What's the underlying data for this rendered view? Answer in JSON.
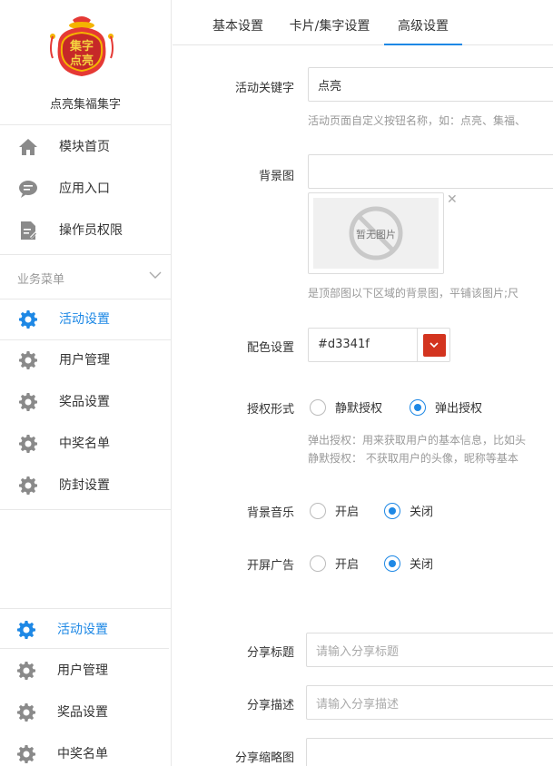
{
  "sidebar": {
    "app_name": "点亮集福集字",
    "logo_text": [
      "集字",
      "点亮"
    ],
    "nav": [
      {
        "label": "模块首页",
        "icon": "home-icon"
      },
      {
        "label": "应用入口",
        "icon": "chat-bubble-icon"
      },
      {
        "label": "操作员权限",
        "icon": "document-edit-icon"
      }
    ],
    "section_title": "业务菜单",
    "menu": [
      {
        "label": "活动设置",
        "active": true
      },
      {
        "label": "用户管理",
        "active": false
      },
      {
        "label": "奖品设置",
        "active": false
      },
      {
        "label": "中奖名单",
        "active": false
      },
      {
        "label": "防封设置",
        "active": false
      }
    ],
    "menu_repeat": [
      {
        "label": "活动设置",
        "active": true
      },
      {
        "label": "用户管理",
        "active": false
      },
      {
        "label": "奖品设置",
        "active": false
      },
      {
        "label": "中奖名单",
        "active": false
      }
    ]
  },
  "tabs": [
    {
      "label": "基本设置",
      "active": false
    },
    {
      "label": "卡片/集字设置",
      "active": false
    },
    {
      "label": "高级设置",
      "active": true
    }
  ],
  "form": {
    "keyword": {
      "label": "活动关键字",
      "value": "点亮",
      "help": "活动页面自定义按钮名称，如：点亮、集福、"
    },
    "bg_image": {
      "label": "背景图",
      "value": "",
      "placeholder_text": "暂无图片",
      "help": "是顶部图以下区域的背景图，平铺该图片;尺"
    },
    "color": {
      "label": "配色设置",
      "value": "#d3341f",
      "swatch": "#d3341f"
    },
    "auth": {
      "label": "授权形式",
      "options": [
        "静默授权",
        "弹出授权"
      ],
      "selected": "弹出授权",
      "help1": "弹出授权：用来获取用户的基本信息，比如头",
      "help2": "静默授权：  不获取用户的头像，昵称等基本"
    },
    "music": {
      "label": "背景音乐",
      "options": [
        "开启",
        "关闭"
      ],
      "selected": "关闭"
    },
    "ad": {
      "label": "开屏广告",
      "options": [
        "开启",
        "关闭"
      ],
      "selected": "关闭"
    },
    "share_title": {
      "label": "分享标题",
      "placeholder": "请输入分享标题"
    },
    "share_desc": {
      "label": "分享描述",
      "placeholder": "请输入分享描述"
    },
    "share_thumb": {
      "label": "分享缩略图"
    }
  },
  "colors": {
    "accent": "#1e88e5",
    "brand_red": "#d3341f"
  }
}
